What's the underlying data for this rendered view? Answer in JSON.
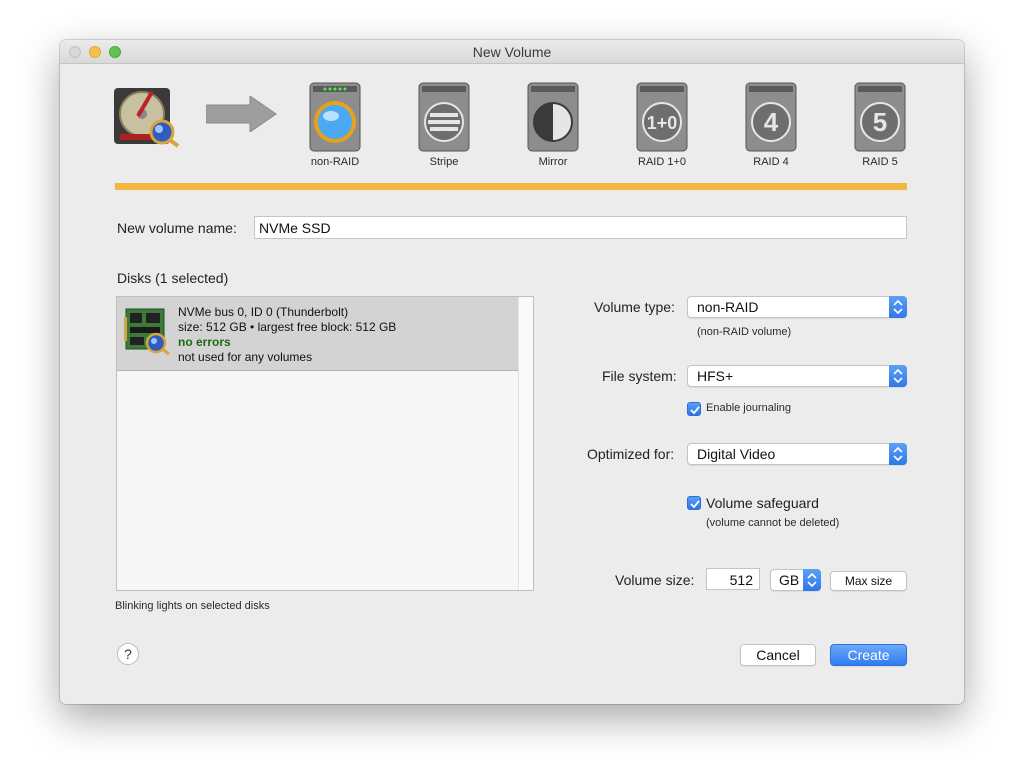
{
  "window": {
    "title": "New Volume"
  },
  "raid_types": [
    {
      "label": "non-RAID",
      "icon": "raid-nonraid-icon"
    },
    {
      "label": "Stripe",
      "icon": "raid-stripe-icon"
    },
    {
      "label": "Mirror",
      "icon": "raid-mirror-icon"
    },
    {
      "label": "RAID 1+0",
      "icon": "raid-10-icon",
      "glyph": "1+0"
    },
    {
      "label": "RAID 4",
      "icon": "raid-4-icon",
      "glyph": "4"
    },
    {
      "label": "RAID 5",
      "icon": "raid-5-icon",
      "glyph": "5"
    }
  ],
  "progress": {
    "fraction": 1.0,
    "color": "#f4b63f"
  },
  "name": {
    "label": "New volume name:",
    "value": "NVMe SSD"
  },
  "disks": {
    "header": "Disks (1 selected)",
    "items": [
      {
        "line1": "NVMe bus 0, ID 0 (Thunderbolt)",
        "line2": "size: 512 GB • largest free block: 512 GB",
        "status": "no errors",
        "line4": "not used for any volumes"
      }
    ],
    "footer": "Blinking lights on selected disks"
  },
  "volume_type": {
    "label": "Volume type:",
    "value": "non-RAID",
    "note": "(non-RAID volume)"
  },
  "file_system": {
    "label": "File system:",
    "value": "HFS+",
    "journaling_label": "Enable journaling",
    "journaling": true
  },
  "optimized": {
    "label": "Optimized for:",
    "value": "Digital Video"
  },
  "safeguard": {
    "label": "Volume safeguard",
    "note": "(volume cannot be deleted)",
    "checked": true
  },
  "size": {
    "label": "Volume size:",
    "value": "512",
    "unit": "GB",
    "max_label": "Max size"
  },
  "buttons": {
    "help": "?",
    "cancel": "Cancel",
    "create": "Create"
  },
  "colors": {
    "accent": "#2f7cf0",
    "ok": "#1c6a12"
  }
}
